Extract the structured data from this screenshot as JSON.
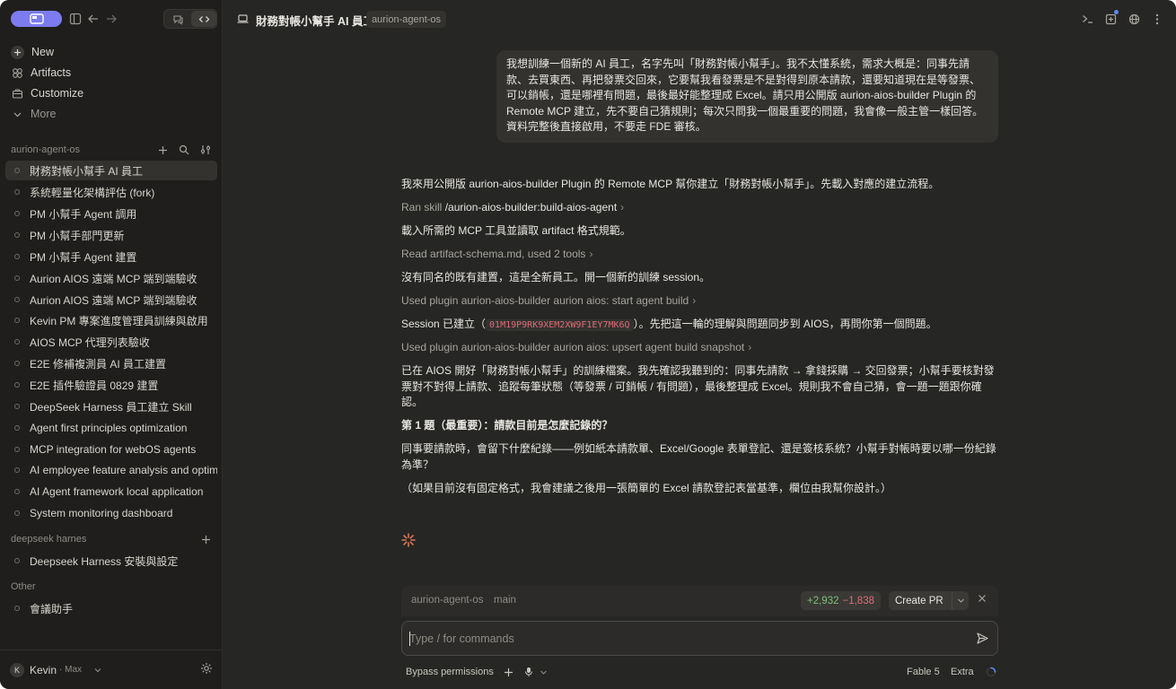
{
  "sidebar": {
    "nav": [
      {
        "label": "New",
        "icon": "plus-icon"
      },
      {
        "label": "Artifacts",
        "icon": "artifacts-icon"
      },
      {
        "label": "Customize",
        "icon": "briefcase-icon"
      },
      {
        "label": "More",
        "icon": "chevron-down-icon"
      }
    ],
    "sections": [
      {
        "title": "aurion-agent-os",
        "items": [
          "財務對帳小幫手 AI 員工",
          "系統輕量化架構評估 (fork)",
          "PM 小幫手 Agent 調用",
          "PM 小幫手部門更新",
          "PM 小幫手 Agent 建置",
          "Aurion AIOS 遠端 MCP 端到端驗收",
          "Aurion AIOS 遠端 MCP 端到端驗收",
          "Kevin PM 專案進度管理員訓練與啟用",
          "AIOS MCP 代理列表驗收",
          "E2E 修補複測員 AI 員工建置",
          "E2E 插件驗證員 0829 建置",
          "DeepSeek Harness 員工建立 Skill",
          "Agent first principles optimization",
          "MCP integration for webOS agents",
          "AI employee feature analysis and optim",
          "AI Agent framework local application",
          "System monitoring dashboard"
        ]
      },
      {
        "title": "deepseek harnes",
        "items": [
          "Deepseek Harness 安裝與設定"
        ]
      },
      {
        "title": "Other",
        "items": [
          "會議助手"
        ]
      }
    ],
    "user": {
      "initial": "K",
      "name": "Kevin",
      "plan": "· Max"
    }
  },
  "header": {
    "title": "財務對帳小幫手 AI 員工",
    "repo": "aurion-agent-os"
  },
  "conversation": {
    "user_message": "我想訓練一個新的 AI 員工，名字先叫「財務對帳小幫手」。我不太懂系統，需求大概是：同事先請款、去買東西、再把發票交回來，它要幫我看發票是不是對得到原本請款，還要知道現在是等發票、可以銷帳，還是哪裡有問題，最後最好能整理成 Excel。請只用公開版 aurion-aios-builder Plugin 的 Remote MCP 建立，先不要自己猜規則；每次只問我一個最重要的問題，我會像一般主管一樣回答。資料完整後直接啟用，不要走 FDE 審核。",
    "r1": "我來用公開版 aurion-aios-builder Plugin 的 Remote MCP 幫你建立「財務對帳小幫手」。先載入對應的建立流程。",
    "t1_prefix": "Ran skill",
    "t1_value": "/aurion-aios-builder:build-aios-agent",
    "r2": "載入所需的 MCP 工具並讀取 artifact 格式規範。",
    "t2": "Read artifact-schema.md, used 2 tools",
    "r3": "沒有同名的既有建置，這是全新員工。開一個新的訓練 session。",
    "t3": "Used plugin aurion-aios-builder aurion aios: start agent build",
    "r4_a": "Session 已建立（",
    "r4_code": "01M19P9RK9XEM2XW9F1EY7MK6Q",
    "r4_b": "）。先把這一輪的理解與問題同步到 AIOS，再問你第一個問題。",
    "t4": "Used plugin aurion-aios-builder aurion aios: upsert agent build snapshot",
    "r5": "已在 AIOS 開好「財務對帳小幫手」的訓練檔案。我先確認我聽到的：同事先請款 → 拿錢採購 → 交回發票；小幫手要核對發票對不對得上請款、追蹤每筆狀態（等發票 / 可銷帳 / 有問題），最後整理成 Excel。規則我不會自己猜，會一題一題跟你確認。",
    "q_title": "第 1 題（最重要）：請款目前是怎麼記錄的？",
    "q_body": "同事要請款時，會留下什麼紀錄——例如紙本請款單、Excel/Google 表單登記、還是簽核系統？小幫手對帳時要以哪一份紀錄為準？",
    "q_note": "（如果目前沒有固定格式，我會建議之後用一張簡單的 Excel 請款登記表當基準，欄位由我幫你設計。）"
  },
  "composer": {
    "repo": "aurion-agent-os",
    "branch": "main",
    "additions": "+2,932",
    "deletions": "−1,838",
    "create_pr": "Create PR",
    "placeholder": "Type / for commands",
    "permissions": "Bypass permissions",
    "model": "Fable 5",
    "effort": "Extra"
  },
  "colors": {
    "accent": "#7c7cf0",
    "addition": "#7fc07a",
    "deletion": "#e06c75",
    "spark": "#d97757"
  }
}
